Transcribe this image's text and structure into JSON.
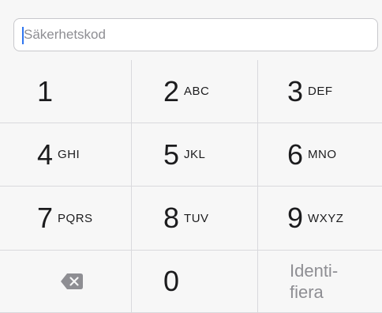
{
  "search": {
    "placeholder": "Säkerhetskod",
    "value": ""
  },
  "keys": [
    {
      "digit": "1",
      "letters": ""
    },
    {
      "digit": "2",
      "letters": "ABC"
    },
    {
      "digit": "3",
      "letters": "DEF"
    },
    {
      "digit": "4",
      "letters": "GHI"
    },
    {
      "digit": "5",
      "letters": "JKL"
    },
    {
      "digit": "6",
      "letters": "MNO"
    },
    {
      "digit": "7",
      "letters": "PQRS"
    },
    {
      "digit": "8",
      "letters": "TUV"
    },
    {
      "digit": "9",
      "letters": "WXYZ"
    }
  ],
  "delete_icon": "delete-backspace-icon",
  "zero_key": "0",
  "identify_key": "Identi-\nfiera",
  "colors": {
    "background": "#f7f7f7",
    "divider": "#d9d9dd",
    "cursor": "#2e75f0",
    "text": "#1c1c1e",
    "muted": "#8e8e93"
  }
}
